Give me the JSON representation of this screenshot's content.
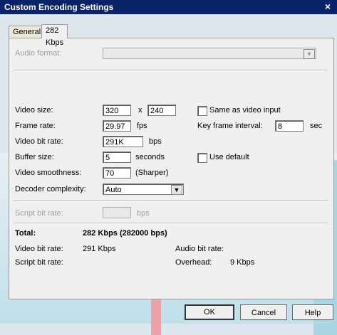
{
  "window": {
    "title": "Custom Encoding Settings",
    "close_glyph": "×"
  },
  "tabs": [
    {
      "label": "General"
    },
    {
      "label": "282 Kbps"
    }
  ],
  "audio": {
    "label": "Audio format:",
    "value": ""
  },
  "video_size": {
    "label": "Video size:",
    "width": "320",
    "x": "x",
    "height": "240"
  },
  "same_as_input": {
    "label": "Same as video input",
    "checked": false
  },
  "frame_rate": {
    "label": "Frame rate:",
    "value": "29.97",
    "unit": "fps"
  },
  "keyframe": {
    "label": "Key frame interval:",
    "value": "8",
    "unit": "sec"
  },
  "video_bitrate": {
    "label": "Video bit rate:",
    "value": "291K",
    "unit": "bps"
  },
  "buffer": {
    "label": "Buffer size:",
    "value": "5",
    "unit": "seconds"
  },
  "use_default": {
    "label": "Use default",
    "checked": false
  },
  "smoothness": {
    "label": "Video smoothness:",
    "value": "70",
    "unit": "(Sharper)"
  },
  "decoder": {
    "label": "Decoder complexity:",
    "value": "Auto"
  },
  "script_rate": {
    "label": "Script bit rate:",
    "value": "",
    "unit": "bps"
  },
  "summary": {
    "total_label": "Total:",
    "total_value": "282 Kbps (282000 bps)",
    "video_label": "Video bit rate:",
    "video_value": "291 Kbps",
    "audio_label": "Audio bit rate:",
    "audio_value": "",
    "script_label": "Script bit rate:",
    "script_value": "",
    "overhead_label": "Overhead:",
    "overhead_value": "9 Kbps"
  },
  "buttons": {
    "ok": "OK",
    "cancel": "Cancel",
    "help": "Help"
  },
  "colors": {
    "titlebar": "#0a246a",
    "accent_band": "#3fb1c8",
    "watermark_red": "#d23c3c"
  }
}
